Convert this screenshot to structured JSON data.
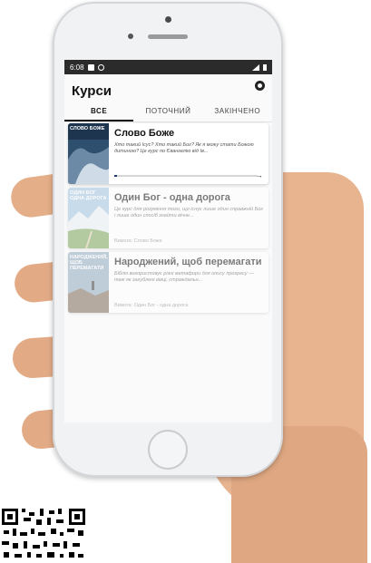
{
  "status": {
    "time": "6:08"
  },
  "app": {
    "title": "Курси"
  },
  "tabs": [
    {
      "label": "ВСЕ",
      "active": true
    },
    {
      "label": "ПОТОЧНИЙ",
      "active": false
    },
    {
      "label": "ЗАКІНЧЕНО",
      "active": false
    }
  ],
  "courses": [
    {
      "title": "Слово Боже",
      "thumb_label": "СЛОВО БОЖЕ",
      "description": "Хто такий Ісус? Хто такий Бог? Як я можу стати Божою дитиною? Це курс по Євангелію від Ів...",
      "progress": 0.02
    },
    {
      "title": "Один Бог - одна дорога",
      "thumb_label": "ОДИН БОГ ОДНА ДОРОГА",
      "description": "Це курс для розуміння того, що існує лише один справжній Бог і лише один спосіб знайти вічне...",
      "footer": "Вимога: Слово Боже"
    },
    {
      "title": "Народжений, щоб перемагати",
      "thumb_label": "НАРОДЖЕНИЙ, ЩОБ ПЕРЕМАГАТИ",
      "description": "Біблія використовує різні метафори для опису прогресу — такі як загублені вівці, страждальн...",
      "footer": "Вимога: Один Бог - одна дорога"
    }
  ],
  "icons": {
    "settings": "gear-icon",
    "next": "arrow-right-icon"
  },
  "colors": {
    "progress": "#1f3b7a",
    "skin": "#e7b48f",
    "statusbar": "#2b2b2b"
  }
}
